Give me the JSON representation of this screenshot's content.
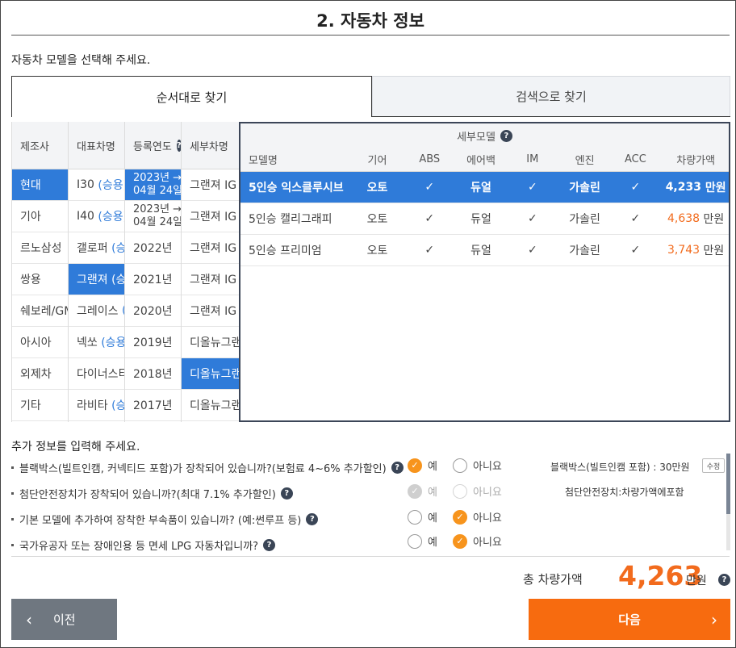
{
  "title": "2. 자동차 정보",
  "subtitle": "자동차 모델을 선택해 주세요.",
  "tabs": [
    {
      "label": "순서대로 찾기"
    },
    {
      "label": "검색으로 찾기"
    }
  ],
  "help_glyph": "?",
  "check_glyph": "✓",
  "columns": {
    "maker": {
      "header": "제조사",
      "items": [
        "현대",
        "기아",
        "르노삼성",
        "쌍용",
        "쉐보레/GM",
        "아시아",
        "외제차",
        "기타"
      ],
      "selected": 0
    },
    "model": {
      "header": "대표차명",
      "items": [
        {
          "name": "I30",
          "category": "(승용)"
        },
        {
          "name": "I40",
          "category": "(승용)"
        },
        {
          "name": "갤로퍼",
          "category": "(승"
        },
        {
          "name": "그랜져",
          "category": "(승"
        },
        {
          "name": "그레이스",
          "category": "("
        },
        {
          "name": "넥쏘",
          "category": "(승용)"
        },
        {
          "name": "다이너스티",
          "category": ""
        },
        {
          "name": "라비타",
          "category": "(승"
        }
      ],
      "selected": 3
    },
    "year": {
      "header": "등록연도",
      "items": [
        {
          "line1": "2023년 →",
          "line2": "04월 24일"
        },
        {
          "line1": "2023년 →",
          "line2": "04월 24일"
        },
        {
          "line1": "2022년",
          "line2": ""
        },
        {
          "line1": "2021년",
          "line2": ""
        },
        {
          "line1": "2020년",
          "line2": ""
        },
        {
          "line1": "2019년",
          "line2": ""
        },
        {
          "line1": "2018년",
          "line2": ""
        },
        {
          "line1": "2017년",
          "line2": ""
        }
      ],
      "selected": 0
    },
    "detail": {
      "header": "세부차명",
      "items": [
        "그랜져 IG",
        "그랜져 IG",
        "그랜져 IG",
        "그랜져 IG",
        "그랜져 IG",
        "디올뉴그랜",
        "디올뉴그랜",
        "디올뉴그랜"
      ],
      "selected": 6
    }
  },
  "submodel": {
    "title": "세부모델",
    "headers": [
      "모델명",
      "기어",
      "ABS",
      "에어백",
      "IM",
      "엔진",
      "ACC",
      "차량가액"
    ],
    "rows": [
      {
        "name": "5인승 익스클루시브",
        "gear": "오토",
        "airbag": "듀얼",
        "engine": "가솔린",
        "price": "4,233",
        "unit": "만원",
        "selected": true
      },
      {
        "name": "5인승 캘리그래피",
        "gear": "오토",
        "airbag": "듀얼",
        "engine": "가솔린",
        "price": "4,638",
        "unit": "만원"
      },
      {
        "name": "5인승 프리미엄",
        "gear": "오토",
        "airbag": "듀얼",
        "engine": "가솔린",
        "price": "3,743",
        "unit": "만원"
      }
    ]
  },
  "extra": {
    "title": "추가 정보를 입력해 주세요.",
    "yes": "예",
    "no": "아니요",
    "questions": [
      {
        "text": "블랙박스(빌트인캠, 커넥티드 포함)가 장착되어 있습니까?(보험료 4~6% 추가할인)",
        "answer": "yes"
      },
      {
        "text": "첨단안전장치가 장착되어 있습니까?(최대 7.1% 추가할인)",
        "answer": "yes-disabled"
      },
      {
        "text": "기본 모델에 추가하여 장착한 부속품이 있습니까? (예:썬루프 등)",
        "answer": "no"
      },
      {
        "text": "국가유공자 또는 장애인용 등 면세 LPG 자동차입니까?",
        "answer": "no"
      }
    ],
    "info1": "블랙박스(빌트인캠 포함) : 30만원",
    "edit_label": "수정",
    "info2": "첨단안전장치:차량가액에포함"
  },
  "total": {
    "label": "총 차량가액",
    "value": "4,263",
    "unit": "만원"
  },
  "nav": {
    "prev": "이전",
    "next": "다음",
    "prev_icon": "‹",
    "next_icon": "›"
  },
  "colors": {
    "accent": "#f76b0f",
    "selected": "#2f7bd9",
    "price": "#f26b1d"
  }
}
